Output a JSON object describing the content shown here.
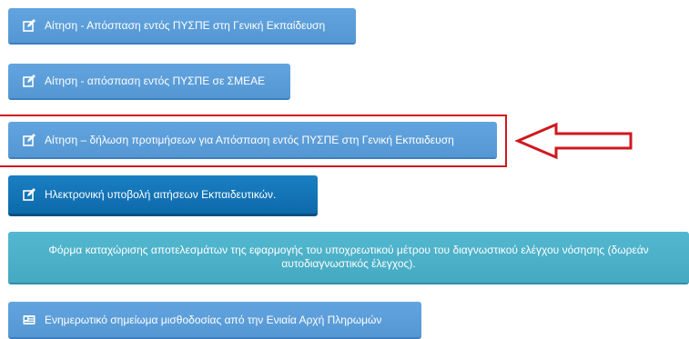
{
  "buttons": [
    {
      "label": "Αίτηση - Απόσπαση εντός ΠΥΣΠΕ στη Γενική Εκπαίδευση",
      "icon": "edit-icon"
    },
    {
      "label": "Αίτηση - απόσπαση εντός ΠΥΣΠΕ σε ΣΜΕΑΕ",
      "icon": "edit-icon"
    },
    {
      "label": "Αίτηση – δήλωση προτιμήσεων για Απόσπαση εντός ΠΥΣΠΕ στη Γενική Εκπαιδευση",
      "icon": "edit-icon"
    },
    {
      "label": "Ηλεκτρονική υποβολή αιτήσεων Εκπαιδευτικών.",
      "icon": "edit-icon"
    },
    {
      "label": "Φόρμα καταχώρισης αποτελεσμάτων της εφαρμογής του υποχρεωτικού μέτρου του διαγνωστικού ελέγχου νόσησης (δωρεάν αυτοδιαγνωστικός έλεγχος)."
    },
    {
      "label": "Ενημερωτικό σημείωμα μισθοδοσίας από την Ενιαία Αρχή Πληρωμών",
      "icon": "id-card-icon"
    }
  ],
  "colors": {
    "button_light": "#5b9bd5",
    "button_dark": "#1274b8",
    "button_teal": "#4bb0c8",
    "annotation_red": "#d0181f"
  }
}
